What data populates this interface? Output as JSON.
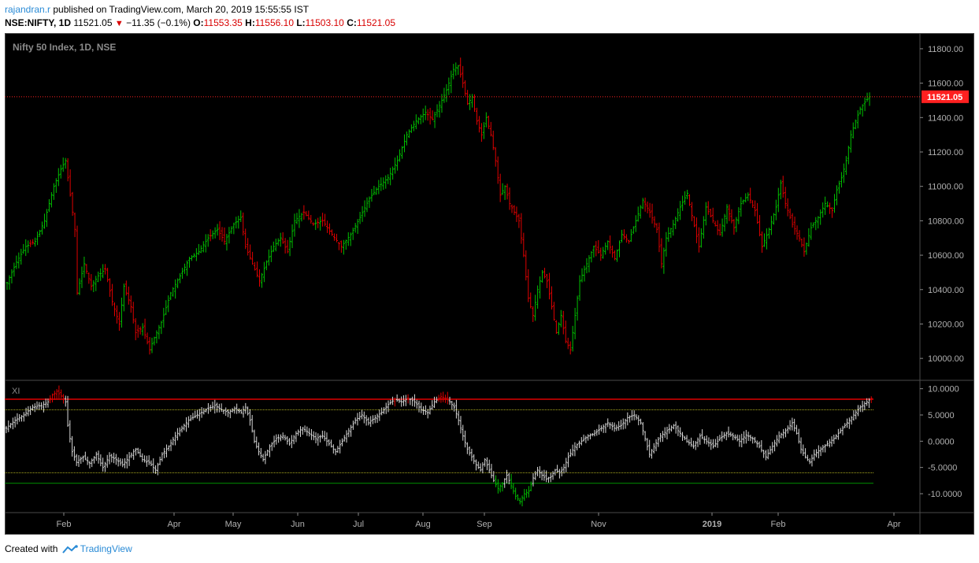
{
  "header": {
    "author": "rajandran.r",
    "published_text": "published on TradingView.com, March 20, 2019 15:55:55 IST",
    "symbol": "NSE:NIFTY, 1D",
    "last": "11521.05",
    "change": "−11.35 (−0.1%)",
    "o_label": "O:",
    "o_value": "11553.35",
    "h_label": "H:",
    "h_value": "11556.10",
    "l_label": "L:",
    "l_value": "11503.10",
    "c_label": "C:",
    "c_value": "11521.05"
  },
  "footer": {
    "created_with": "Created with",
    "brand": "TradingView"
  },
  "colors": {
    "background": "#000000",
    "up": "#00c000",
    "down": "#e00000",
    "neutral": "#d8d8d8",
    "price_line": "#ff2020",
    "upper_level": "#e00000",
    "lower_level": "#008000",
    "inner_levels": "#b0b020"
  },
  "chart_data": [
    {
      "type": "ohlc",
      "title": "Nifty 50 Index, 1D, NSE",
      "price_label": "11521.05",
      "current_price": 11521.05,
      "ylim": [
        9900,
        11850
      ],
      "y_ticks": [
        "11800.00",
        "11600.00",
        "11400.00",
        "11200.00",
        "11000.00",
        "10800.00",
        "10600.00",
        "10400.00",
        "10200.00",
        "10000.00"
      ],
      "x_ticks": [
        "Feb",
        "Apr",
        "May",
        "Jun",
        "Jul",
        "Aug",
        "Sep",
        "Nov",
        "2019",
        "Feb",
        "Apr"
      ],
      "series_close": [
        {
          "t": 0,
          "v": 10440
        },
        {
          "t": 4,
          "v": 10560
        },
        {
          "t": 8,
          "v": 10650
        },
        {
          "t": 12,
          "v": 10680
        },
        {
          "t": 16,
          "v": 10800
        },
        {
          "t": 20,
          "v": 11000
        },
        {
          "t": 23,
          "v": 11100
        },
        {
          "t": 25,
          "v": 11150
        },
        {
          "t": 27,
          "v": 10950
        },
        {
          "t": 29,
          "v": 10750
        },
        {
          "t": 30,
          "v": 10380
        },
        {
          "t": 33,
          "v": 10550
        },
        {
          "t": 36,
          "v": 10420
        },
        {
          "t": 39,
          "v": 10480
        },
        {
          "t": 42,
          "v": 10520
        },
        {
          "t": 45,
          "v": 10330
        },
        {
          "t": 48,
          "v": 10200
        },
        {
          "t": 50,
          "v": 10420
        },
        {
          "t": 53,
          "v": 10300
        },
        {
          "t": 55,
          "v": 10150
        },
        {
          "t": 58,
          "v": 10180
        },
        {
          "t": 61,
          "v": 10050
        },
        {
          "t": 63,
          "v": 10120
        },
        {
          "t": 66,
          "v": 10210
        },
        {
          "t": 70,
          "v": 10380
        },
        {
          "t": 74,
          "v": 10480
        },
        {
          "t": 78,
          "v": 10580
        },
        {
          "t": 82,
          "v": 10620
        },
        {
          "t": 86,
          "v": 10700
        },
        {
          "t": 90,
          "v": 10750
        },
        {
          "t": 93,
          "v": 10680
        },
        {
          "t": 97,
          "v": 10780
        },
        {
          "t": 100,
          "v": 10820
        },
        {
          "t": 102,
          "v": 10650
        },
        {
          "t": 105,
          "v": 10550
        },
        {
          "t": 108,
          "v": 10450
        },
        {
          "t": 111,
          "v": 10560
        },
        {
          "t": 114,
          "v": 10650
        },
        {
          "t": 117,
          "v": 10700
        },
        {
          "t": 120,
          "v": 10620
        },
        {
          "t": 123,
          "v": 10800
        },
        {
          "t": 127,
          "v": 10850
        },
        {
          "t": 131,
          "v": 10780
        },
        {
          "t": 135,
          "v": 10800
        },
        {
          "t": 139,
          "v": 10720
        },
        {
          "t": 143,
          "v": 10650
        },
        {
          "t": 147,
          "v": 10720
        },
        {
          "t": 151,
          "v": 10820
        },
        {
          "t": 155,
          "v": 10930
        },
        {
          "t": 159,
          "v": 11000
        },
        {
          "t": 163,
          "v": 11050
        },
        {
          "t": 167,
          "v": 11150
        },
        {
          "t": 171,
          "v": 11300
        },
        {
          "t": 175,
          "v": 11380
        },
        {
          "t": 179,
          "v": 11430
        },
        {
          "t": 182,
          "v": 11390
        },
        {
          "t": 185,
          "v": 11470
        },
        {
          "t": 188,
          "v": 11560
        },
        {
          "t": 191,
          "v": 11680
        },
        {
          "t": 193,
          "v": 11700
        },
        {
          "t": 195,
          "v": 11600
        },
        {
          "t": 197,
          "v": 11480
        },
        {
          "t": 199,
          "v": 11520
        },
        {
          "t": 201,
          "v": 11380
        },
        {
          "t": 203,
          "v": 11300
        },
        {
          "t": 205,
          "v": 11400
        },
        {
          "t": 207,
          "v": 11300
        },
        {
          "t": 209,
          "v": 11150
        },
        {
          "t": 211,
          "v": 10950
        },
        {
          "t": 213,
          "v": 11000
        },
        {
          "t": 215,
          "v": 10900
        },
        {
          "t": 217,
          "v": 10850
        },
        {
          "t": 219,
          "v": 10800
        },
        {
          "t": 221,
          "v": 10600
        },
        {
          "t": 223,
          "v": 10350
        },
        {
          "t": 225,
          "v": 10250
        },
        {
          "t": 227,
          "v": 10400
        },
        {
          "t": 229,
          "v": 10500
        },
        {
          "t": 231,
          "v": 10450
        },
        {
          "t": 233,
          "v": 10300
        },
        {
          "t": 235,
          "v": 10150
        },
        {
          "t": 237,
          "v": 10250
        },
        {
          "t": 239,
          "v": 10100
        },
        {
          "t": 241,
          "v": 10050
        },
        {
          "t": 243,
          "v": 10250
        },
        {
          "t": 245,
          "v": 10450
        },
        {
          "t": 248,
          "v": 10550
        },
        {
          "t": 251,
          "v": 10650
        },
        {
          "t": 254,
          "v": 10600
        },
        {
          "t": 257,
          "v": 10680
        },
        {
          "t": 260,
          "v": 10580
        },
        {
          "t": 263,
          "v": 10720
        },
        {
          "t": 266,
          "v": 10680
        },
        {
          "t": 269,
          "v": 10800
        },
        {
          "t": 272,
          "v": 10920
        },
        {
          "t": 275,
          "v": 10850
        },
        {
          "t": 278,
          "v": 10750
        },
        {
          "t": 280,
          "v": 10550
        },
        {
          "t": 282,
          "v": 10700
        },
        {
          "t": 285,
          "v": 10780
        },
        {
          "t": 288,
          "v": 10880
        },
        {
          "t": 291,
          "v": 10960
        },
        {
          "t": 293,
          "v": 10830
        },
        {
          "t": 296,
          "v": 10650
        },
        {
          "t": 299,
          "v": 10880
        },
        {
          "t": 302,
          "v": 10800
        },
        {
          "t": 305,
          "v": 10720
        },
        {
          "t": 308,
          "v": 10880
        },
        {
          "t": 311,
          "v": 10760
        },
        {
          "t": 314,
          "v": 10900
        },
        {
          "t": 317,
          "v": 10950
        },
        {
          "t": 320,
          "v": 10860
        },
        {
          "t": 323,
          "v": 10650
        },
        {
          "t": 326,
          "v": 10750
        },
        {
          "t": 329,
          "v": 10880
        },
        {
          "t": 331,
          "v": 11020
        },
        {
          "t": 333,
          "v": 10900
        },
        {
          "t": 336,
          "v": 10780
        },
        {
          "t": 339,
          "v": 10700
        },
        {
          "t": 341,
          "v": 10620
        },
        {
          "t": 344,
          "v": 10760
        },
        {
          "t": 347,
          "v": 10820
        },
        {
          "t": 350,
          "v": 10900
        },
        {
          "t": 353,
          "v": 10860
        },
        {
          "t": 355,
          "v": 10980
        },
        {
          "t": 357,
          "v": 11050
        },
        {
          "t": 359,
          "v": 11150
        },
        {
          "t": 361,
          "v": 11300
        },
        {
          "t": 363,
          "v": 11380
        },
        {
          "t": 365,
          "v": 11450
        },
        {
          "t": 367,
          "v": 11490
        },
        {
          "t": 369,
          "v": 11521.05
        }
      ]
    },
    {
      "type": "ohlc-oscillator",
      "title": "XI",
      "ylim": [
        -13,
        11
      ],
      "y_ticks": [
        "10.0000",
        "5.0000",
        "0.0000",
        "-5.0000",
        "-10.0000"
      ],
      "levels": {
        "upper": 8,
        "upper_inner": 6,
        "lower_inner": -6,
        "lower": -8
      },
      "series_close": [
        {
          "t": 0,
          "v": 2.5
        },
        {
          "t": 4,
          "v": 4
        },
        {
          "t": 8,
          "v": 5
        },
        {
          "t": 12,
          "v": 6.5
        },
        {
          "t": 16,
          "v": 6.8
        },
        {
          "t": 19,
          "v": 7.5
        },
        {
          "t": 21,
          "v": 8.8
        },
        {
          "t": 23,
          "v": 9.5
        },
        {
          "t": 25,
          "v": 8.6
        },
        {
          "t": 27,
          "v": 7.5
        },
        {
          "t": 28,
          "v": 3
        },
        {
          "t": 30,
          "v": -2
        },
        {
          "t": 32,
          "v": -4
        },
        {
          "t": 35,
          "v": -3
        },
        {
          "t": 38,
          "v": -4.2
        },
        {
          "t": 41,
          "v": -2.5
        },
        {
          "t": 44,
          "v": -5
        },
        {
          "t": 47,
          "v": -2.8
        },
        {
          "t": 50,
          "v": -3.5
        },
        {
          "t": 53,
          "v": -4.5
        },
        {
          "t": 56,
          "v": -3
        },
        {
          "t": 59,
          "v": -1.5
        },
        {
          "t": 62,
          "v": -3.5
        },
        {
          "t": 65,
          "v": -4
        },
        {
          "t": 68,
          "v": -5.5
        },
        {
          "t": 71,
          "v": -2.5
        },
        {
          "t": 74,
          "v": -1
        },
        {
          "t": 77,
          "v": 1
        },
        {
          "t": 80,
          "v": 2.5
        },
        {
          "t": 83,
          "v": 4
        },
        {
          "t": 87,
          "v": 5
        },
        {
          "t": 91,
          "v": 6
        },
        {
          "t": 95,
          "v": 6.8
        },
        {
          "t": 98,
          "v": 6
        },
        {
          "t": 101,
          "v": 5.5
        },
        {
          "t": 104,
          "v": 6.2
        },
        {
          "t": 107,
          "v": 5.5
        },
        {
          "t": 109,
          "v": 6.5
        },
        {
          "t": 111,
          "v": 4
        },
        {
          "t": 113,
          "v": 0
        },
        {
          "t": 115,
          "v": -2
        },
        {
          "t": 117,
          "v": -3.5
        },
        {
          "t": 120,
          "v": -1
        },
        {
          "t": 123,
          "v": 0.5
        },
        {
          "t": 126,
          "v": 1
        },
        {
          "t": 129,
          "v": -0.5
        },
        {
          "t": 132,
          "v": 1.5
        },
        {
          "t": 135,
          "v": 2.5
        },
        {
          "t": 138,
          "v": 1.5
        },
        {
          "t": 141,
          "v": 0.5
        },
        {
          "t": 144,
          "v": 1
        },
        {
          "t": 147,
          "v": -0.5
        },
        {
          "t": 150,
          "v": -2
        },
        {
          "t": 153,
          "v": 0
        },
        {
          "t": 156,
          "v": 2
        },
        {
          "t": 159,
          "v": 4
        },
        {
          "t": 162,
          "v": 5
        },
        {
          "t": 165,
          "v": 3.5
        },
        {
          "t": 168,
          "v": 4.5
        },
        {
          "t": 171,
          "v": 5.5
        },
        {
          "t": 174,
          "v": 7
        },
        {
          "t": 177,
          "v": 8
        },
        {
          "t": 180,
          "v": 7.5
        },
        {
          "t": 183,
          "v": 8.2
        },
        {
          "t": 186,
          "v": 7.5
        },
        {
          "t": 189,
          "v": 6
        },
        {
          "t": 192,
          "v": 5.5
        },
        {
          "t": 195,
          "v": 7.5
        },
        {
          "t": 198,
          "v": 8.5
        },
        {
          "t": 201,
          "v": 8
        },
        {
          "t": 204,
          "v": 6.5
        },
        {
          "t": 206,
          "v": 4
        },
        {
          "t": 208,
          "v": 1
        },
        {
          "t": 210,
          "v": -1.5
        },
        {
          "t": 212,
          "v": -3
        },
        {
          "t": 214,
          "v": -4.5
        },
        {
          "t": 216,
          "v": -5.5
        },
        {
          "t": 218,
          "v": -3.5
        },
        {
          "t": 220,
          "v": -5.5
        },
        {
          "t": 222,
          "v": -7.5
        },
        {
          "t": 224,
          "v": -9
        },
        {
          "t": 226,
          "v": -8
        },
        {
          "t": 228,
          "v": -6.5
        },
        {
          "t": 230,
          "v": -8.5
        },
        {
          "t": 232,
          "v": -10.5
        },
        {
          "t": 234,
          "v": -11.5
        },
        {
          "t": 236,
          "v": -10
        },
        {
          "t": 238,
          "v": -9.5
        },
        {
          "t": 240,
          "v": -7
        },
        {
          "t": 242,
          "v": -5.5
        },
        {
          "t": 244,
          "v": -6.5
        },
        {
          "t": 246,
          "v": -7.2
        },
        {
          "t": 248,
          "v": -6.8
        },
        {
          "t": 250,
          "v": -5.5
        },
        {
          "t": 252,
          "v": -6
        },
        {
          "t": 254,
          "v": -5
        },
        {
          "t": 256,
          "v": -3
        },
        {
          "t": 259,
          "v": -1
        },
        {
          "t": 262,
          "v": 0
        },
        {
          "t": 265,
          "v": 1
        },
        {
          "t": 268,
          "v": 1.5
        },
        {
          "t": 271,
          "v": 2.5
        },
        {
          "t": 274,
          "v": 3.5
        },
        {
          "t": 277,
          "v": 2.5
        },
        {
          "t": 280,
          "v": 3
        },
        {
          "t": 283,
          "v": 4.5
        },
        {
          "t": 286,
          "v": 5
        },
        {
          "t": 289,
          "v": 3.5
        },
        {
          "t": 291,
          "v": 0.5
        },
        {
          "t": 293,
          "v": -2.5
        },
        {
          "t": 295,
          "v": -1
        },
        {
          "t": 298,
          "v": 1
        },
        {
          "t": 301,
          "v": 2
        },
        {
          "t": 304,
          "v": 3
        },
        {
          "t": 307,
          "v": 1.5
        },
        {
          "t": 310,
          "v": 0
        },
        {
          "t": 313,
          "v": -1
        },
        {
          "t": 316,
          "v": 1
        },
        {
          "t": 319,
          "v": 0
        },
        {
          "t": 322,
          "v": -1
        },
        {
          "t": 325,
          "v": 0.5
        },
        {
          "t": 328,
          "v": 1.5
        },
        {
          "t": 331,
          "v": 1
        },
        {
          "t": 334,
          "v": 0
        },
        {
          "t": 337,
          "v": 1.2
        },
        {
          "t": 340,
          "v": 0.5
        },
        {
          "t": 343,
          "v": -1
        },
        {
          "t": 346,
          "v": -3
        },
        {
          "t": 349,
          "v": -1
        },
        {
          "t": 352,
          "v": 1
        },
        {
          "t": 355,
          "v": 2
        },
        {
          "t": 358,
          "v": 3.5
        },
        {
          "t": 360,
          "v": 1.5
        },
        {
          "t": 362,
          "v": -1.5
        },
        {
          "t": 364,
          "v": -3
        },
        {
          "t": 366,
          "v": -4
        },
        {
          "t": 368,
          "v": -2.5
        },
        {
          "t": 371,
          "v": -1.5
        },
        {
          "t": 374,
          "v": -0.5
        },
        {
          "t": 377,
          "v": 0.5
        },
        {
          "t": 380,
          "v": 2
        },
        {
          "t": 383,
          "v": 3.5
        },
        {
          "t": 386,
          "v": 5
        },
        {
          "t": 389,
          "v": 6.5
        },
        {
          "t": 392,
          "v": 7.5
        },
        {
          "t": 394,
          "v": 8.2
        }
      ]
    }
  ]
}
